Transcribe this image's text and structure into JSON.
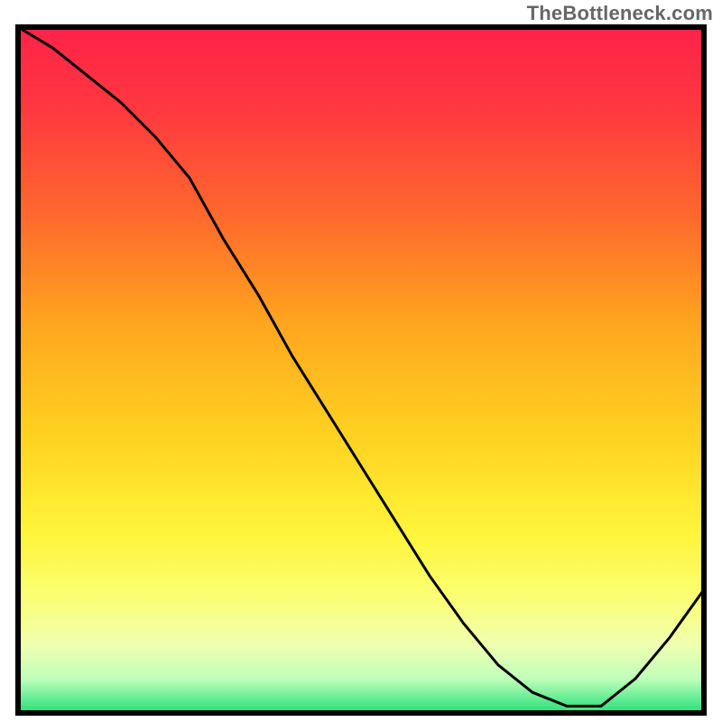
{
  "watermark": "TheBottleneck.com",
  "chart_data": {
    "type": "line",
    "title": "",
    "xlabel": "",
    "ylabel": "",
    "xlim": [
      0,
      100
    ],
    "ylim": [
      0,
      100
    ],
    "legend": false,
    "grid": false,
    "series": [
      {
        "name": "curve",
        "x": [
          0,
          5,
          10,
          15,
          20,
          25,
          30,
          35,
          40,
          45,
          50,
          55,
          60,
          65,
          70,
          75,
          80,
          85,
          90,
          95,
          100
        ],
        "y": [
          100,
          97,
          93,
          89,
          84,
          78,
          69,
          61,
          52,
          44,
          36,
          28,
          20,
          13,
          7,
          3,
          1,
          1,
          5,
          11,
          18
        ]
      }
    ],
    "background_gradient": {
      "stops": [
        {
          "offset": 0.0,
          "color": "#ff2249"
        },
        {
          "offset": 0.12,
          "color": "#ff3840"
        },
        {
          "offset": 0.28,
          "color": "#ff6a2c"
        },
        {
          "offset": 0.44,
          "color": "#ffa81e"
        },
        {
          "offset": 0.6,
          "color": "#ffd321"
        },
        {
          "offset": 0.74,
          "color": "#fff53a"
        },
        {
          "offset": 0.84,
          "color": "#faff7a"
        },
        {
          "offset": 0.9,
          "color": "#f0ffb0"
        },
        {
          "offset": 0.95,
          "color": "#c0ffba"
        },
        {
          "offset": 1.0,
          "color": "#22e07a"
        }
      ]
    },
    "colors": {
      "border": "#000000",
      "curve": "#000000"
    }
  }
}
